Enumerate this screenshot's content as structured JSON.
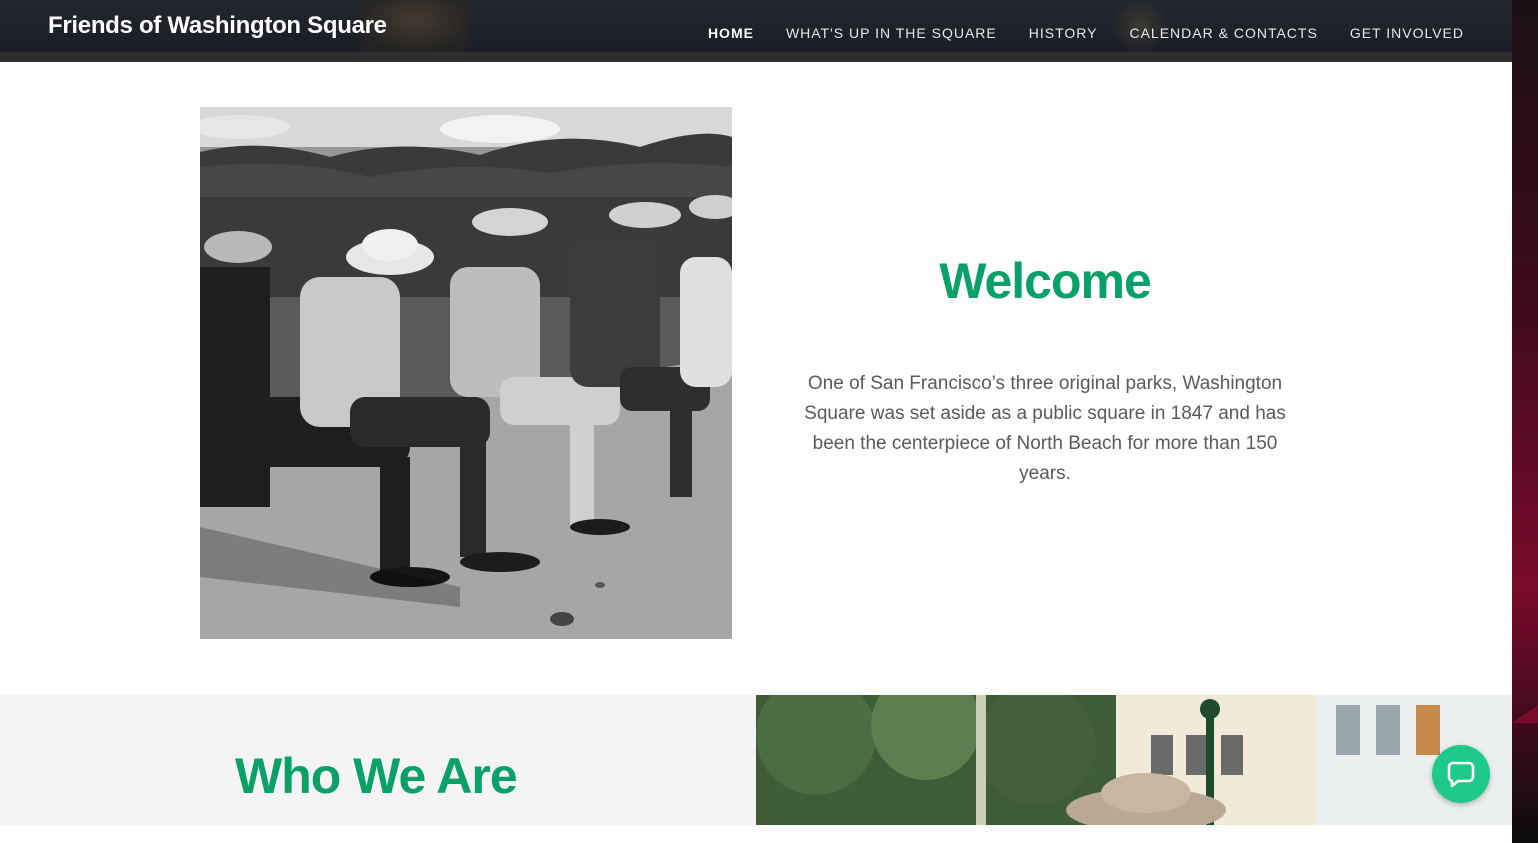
{
  "site": {
    "title": "Friends of Washington Square"
  },
  "nav": {
    "items": [
      {
        "label": "HOME",
        "active": true
      },
      {
        "label": "WHAT'S UP IN THE SQUARE",
        "active": false
      },
      {
        "label": "HISTORY",
        "active": false
      },
      {
        "label": "CALENDAR & CONTACTS",
        "active": false
      },
      {
        "label": "GET INVOLVED",
        "active": false
      }
    ]
  },
  "welcome": {
    "title": "Welcome",
    "body": "One of San Francisco’s three original parks, Washington Square was set aside as a public square in 1847 and has been the centerpiece of North Beach for more than 150 years."
  },
  "who": {
    "title": "Who We Are"
  },
  "chat": {
    "icon": "chat-bubble-icon"
  },
  "colors": {
    "accent": "#0aa06a",
    "header_bg": "#1b1e25",
    "chat": "#1fc98a",
    "body_text": "#5a5a5a"
  }
}
